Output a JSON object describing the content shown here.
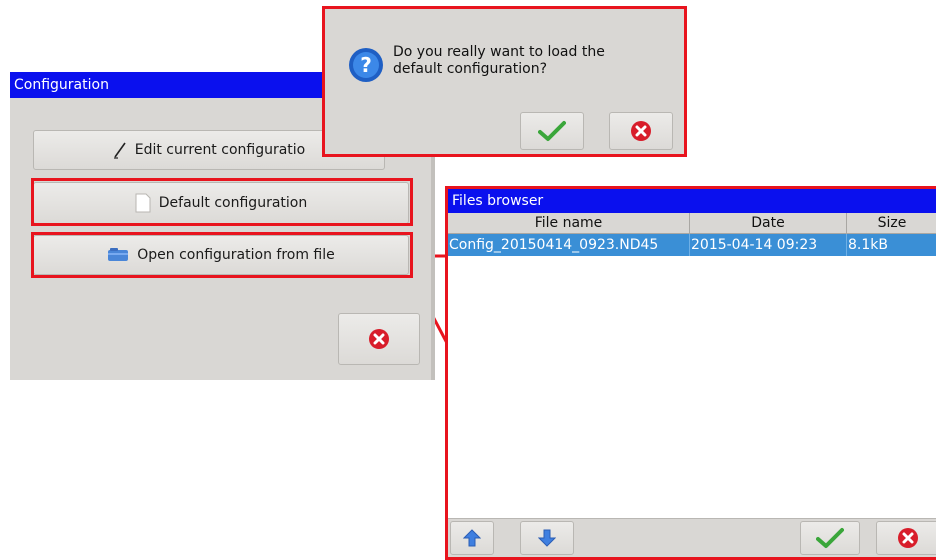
{
  "config_window": {
    "title": "Configuration",
    "edit_label": "Edit current configuratio",
    "default_label": "Default configuration",
    "open_label": "Open configuration from file"
  },
  "confirm_dialog": {
    "message_line1": "Do you really want to load the",
    "message_line2": "default configuration?"
  },
  "files_browser": {
    "title": "Files browser",
    "columns": [
      "File name",
      "Date",
      "Size"
    ],
    "rows": [
      {
        "file_name": "Config_20150414_0923.ND45",
        "date": "2015-04-14 09:23",
        "size": "8.1kB"
      }
    ]
  },
  "colors": {
    "titlebar": "#0a10ee",
    "highlight": "#e8141e",
    "selection": "#3a8fd6",
    "window_bg": "#d9d7d4"
  },
  "icons": {
    "question": "question-icon",
    "ok": "check-icon",
    "cancel": "cancel-icon",
    "up": "arrow-up-icon",
    "down": "arrow-down-icon",
    "edit": "pencil-icon",
    "default": "blank-page-icon",
    "open": "folder-icon"
  }
}
